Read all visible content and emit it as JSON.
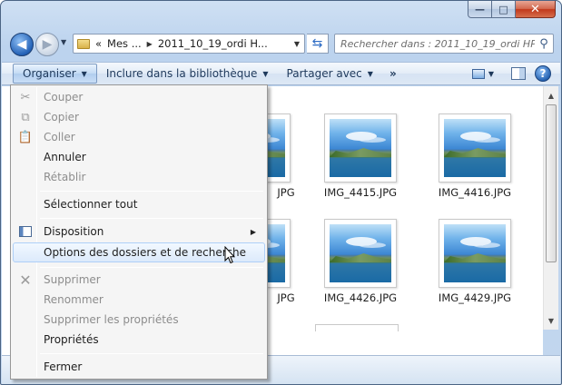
{
  "window": {
    "controls": {
      "minimize": "—",
      "maximize": "□",
      "close": "✕"
    }
  },
  "nav": {
    "back_icon": "back-arrow-icon",
    "forward_icon": "forward-arrow-icon",
    "address": {
      "overflow": "«",
      "segments": [
        "Mes ...",
        "2011_10_19_ordi H..."
      ],
      "separator": "▶"
    },
    "search": {
      "placeholder": "Rechercher dans : 2011_10_19_ordi HP..."
    }
  },
  "commandbar": {
    "organize": "Organiser",
    "include": "Inclure dans la bibliothèque",
    "share": "Partager avec",
    "more": "»",
    "help": "?"
  },
  "files": [
    {
      "name": "IMG_4415.JPG"
    },
    {
      "name": "IMG_4416.JPG"
    },
    {
      "name": "IMG_4426.JPG"
    },
    {
      "name": "IMG_4429.JPG"
    },
    {
      "partial_name_1": ".JPG",
      "partial_name_2": ".JPG"
    }
  ],
  "partial_labels": {
    "row1": "JPG",
    "row2": "JPG"
  },
  "menu": {
    "items": [
      {
        "label": "Couper",
        "enabled": false,
        "icon": "scissors-icon"
      },
      {
        "label": "Copier",
        "enabled": false,
        "icon": "copy-icon"
      },
      {
        "label": "Coller",
        "enabled": false,
        "icon": "paste-icon"
      },
      {
        "label": "Annuler",
        "enabled": true
      },
      {
        "label": "Rétablir",
        "enabled": false
      },
      {
        "label": "Sélectionner tout",
        "enabled": true
      },
      {
        "label": "Disposition",
        "enabled": true,
        "icon": "layout-icon",
        "submenu": true
      },
      {
        "label": "Options des dossiers et de recherche",
        "enabled": true,
        "highlighted": true
      },
      {
        "label": "Supprimer",
        "enabled": false,
        "icon": "delete-x-icon"
      },
      {
        "label": "Renommer",
        "enabled": false
      },
      {
        "label": "Supprimer les propriétés",
        "enabled": false
      },
      {
        "label": "Propriétés",
        "enabled": true
      },
      {
        "label": "Fermer",
        "enabled": true
      }
    ]
  },
  "colors": {
    "accent": "#2361b6",
    "menu_highlight": "#dceafb",
    "disabled_text": "#8d8d8d"
  }
}
